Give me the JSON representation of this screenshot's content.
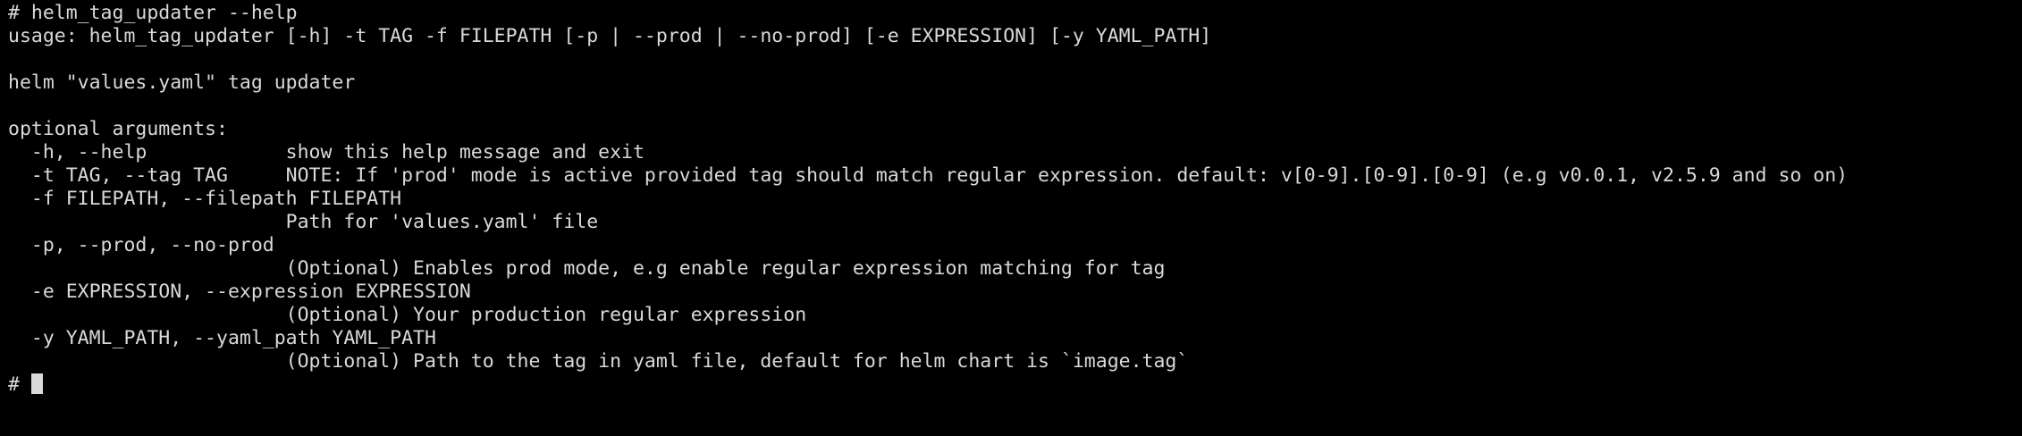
{
  "terminal": {
    "lines": [
      "# helm_tag_updater --help",
      "usage: helm_tag_updater [-h] -t TAG -f FILEPATH [-p | --prod | --no-prod] [-e EXPRESSION] [-y YAML_PATH]",
      "",
      "helm \"values.yaml\" tag updater",
      "",
      "optional arguments:",
      "  -h, --help            show this help message and exit",
      "  -t TAG, --tag TAG     NOTE: If 'prod' mode is active provided tag should match regular expression. default: v[0-9].[0-9].[0-9] (e.g v0.0.1, v2.5.9 and so on)",
      "  -f FILEPATH, --filepath FILEPATH",
      "                        Path for 'values.yaml' file",
      "  -p, --prod, --no-prod",
      "                        (Optional) Enables prod mode, e.g enable regular expression matching for tag",
      "  -e EXPRESSION, --expression EXPRESSION",
      "                        (Optional) Your production regular expression",
      "  -y YAML_PATH, --yaml_path YAML_PATH",
      "                        (Optional) Path to the tag in yaml file, default for helm chart is `image.tag`"
    ],
    "prompt": "# "
  }
}
